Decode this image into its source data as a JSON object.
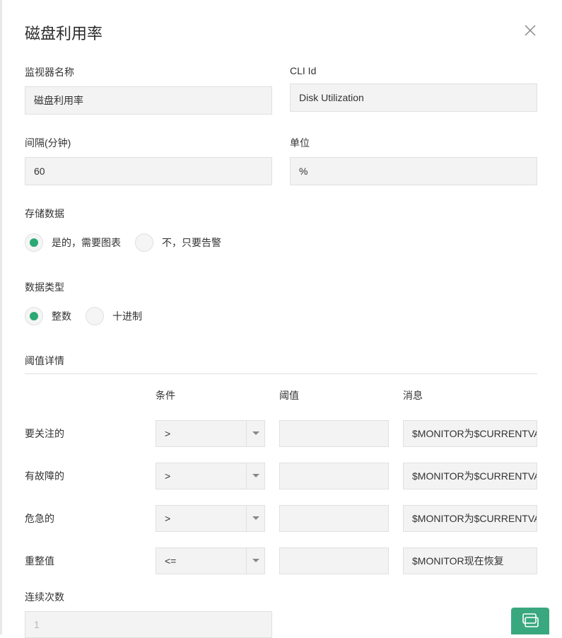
{
  "title": "磁盘利用率",
  "fields": {
    "monitor_name": {
      "label": "监视器名称",
      "value": "磁盘利用率"
    },
    "cli_id": {
      "label": "CLI Id",
      "value": "Disk Utilization"
    },
    "interval": {
      "label": "间隔(分钟)",
      "value": "60"
    },
    "unit": {
      "label": "单位",
      "value": "%"
    }
  },
  "store_data": {
    "label": "存储数据",
    "options": [
      {
        "label": "是的，需要图表",
        "checked": true
      },
      {
        "label": "不，只要告警",
        "checked": false
      }
    ]
  },
  "data_type": {
    "label": "数据类型",
    "options": [
      {
        "label": "整数",
        "checked": true
      },
      {
        "label": "十进制",
        "checked": false
      }
    ]
  },
  "thresholds": {
    "title": "阈值详情",
    "headers": {
      "condition": "条件",
      "value": "阈值",
      "message": "消息"
    },
    "rows": [
      {
        "label": "要关注的",
        "condition": ">",
        "value": "",
        "message": "$MONITOR为$CURRENTVALUE"
      },
      {
        "label": "有故障的",
        "condition": ">",
        "value": "",
        "message": "$MONITOR为$CURRENTVALUE"
      },
      {
        "label": "危急的",
        "condition": ">",
        "value": "",
        "message": "$MONITOR为$CURRENTVALUE"
      },
      {
        "label": "重整值",
        "condition": "<=",
        "value": "",
        "message": "$MONITOR现在恢复"
      }
    ]
  },
  "consecutive": {
    "label": "连续次数",
    "value": "1"
  }
}
